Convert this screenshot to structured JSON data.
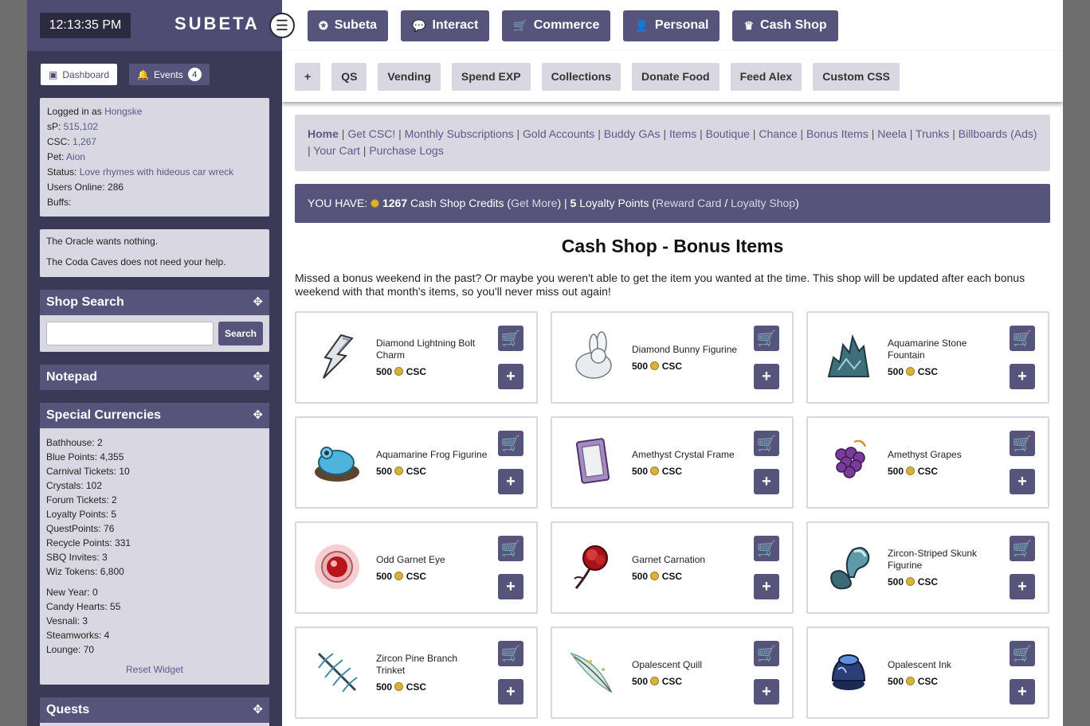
{
  "sidebar": {
    "clock": "12:13:35 PM",
    "brand": "SUBETA",
    "tabs": {
      "dashboard": "Dashboard",
      "events": "Events",
      "events_count": "4"
    },
    "user": {
      "logged_in_label": "Logged in as",
      "username": "Hongske",
      "sp_label": "sP:",
      "sp_value": "515,102",
      "csc_label": "CSC:",
      "csc_value": "1,267",
      "pet_label": "Pet:",
      "pet_value": "Aion",
      "status_label": "Status:",
      "status_value": "Love rhymes with hideous car wreck",
      "users_online": "Users Online: 286",
      "buffs": "Buffs:"
    },
    "oracle": {
      "line1": "The Oracle wants nothing.",
      "line2": "The Coda Caves does not need your help."
    },
    "shop_search": {
      "title": "Shop Search",
      "button": "Search",
      "placeholder": ""
    },
    "notepad": {
      "title": "Notepad"
    },
    "currencies": {
      "title": "Special Currencies",
      "group1": [
        "Bathhouse: 2",
        "Blue Points: 4,355",
        "Carnival Tickets: 10",
        "Crystals: 102",
        "Forum Tickets: 2",
        "Loyalty Points: 5",
        "QuestPoints: 76",
        "Recycle Points: 331",
        "SBQ Invites: 3",
        "Wiz Tokens: 6,800"
      ],
      "group2": [
        "New Year: 0",
        "Candy Hearts: 55",
        "Vesnali: 3",
        "Steamworks: 4",
        "Lounge: 70"
      ],
      "reset": "Reset Widget"
    },
    "quests": {
      "title": "Quests"
    }
  },
  "topnav": [
    {
      "label": "Subeta",
      "icon": "compass-icon",
      "glyph": "✪"
    },
    {
      "label": "Interact",
      "icon": "chat-icon",
      "glyph": "💬"
    },
    {
      "label": "Commerce",
      "icon": "cart-icon",
      "glyph": "🛒"
    },
    {
      "label": "Personal",
      "icon": "user-icon",
      "glyph": "👤"
    },
    {
      "label": "Cash Shop",
      "icon": "crown-icon",
      "glyph": "♛"
    }
  ],
  "subnav": [
    "+",
    "QS",
    "Vending",
    "Spend EXP",
    "Collections",
    "Donate Food",
    "Feed Alex",
    "Custom CSS"
  ],
  "breadcrumb": [
    "Home",
    "Get CSC!",
    "Monthly Subscriptions",
    "Gold Accounts",
    "Buddy GAs",
    "Items",
    "Boutique",
    "Chance",
    "Bonus Items",
    "Neela",
    "Trunks",
    "Billboards (Ads)",
    "Your Cart",
    "Purchase Logs"
  ],
  "balance": {
    "you_have": "YOU HAVE:",
    "credits": "1267",
    "credits_label": "Cash Shop Credits (",
    "get_more": "Get More",
    "sep": ") |",
    "loyalty": "5",
    "loyalty_label": "Loyalty Points (",
    "reward_card": "Reward Card",
    "slash": " / ",
    "loyalty_shop": "Loyalty Shop",
    "close": ")"
  },
  "page_title": "Cash Shop - Bonus Items",
  "intro": "Missed a bonus weekend in the past? Or maybe you weren't able to get the item you wanted at the time. This shop will be updated after each bonus weekend with that month's items, so you'll never miss out again!",
  "items": [
    {
      "name": "Diamond Lightning Bolt Charm",
      "price": "500",
      "currency": "CSC",
      "kind": "bolt"
    },
    {
      "name": "Diamond Bunny Figurine",
      "price": "500",
      "currency": "CSC",
      "kind": "bunny"
    },
    {
      "name": "Aquamarine Stone Fountain",
      "price": "500",
      "currency": "CSC",
      "kind": "fountain"
    },
    {
      "name": "Aquamarine Frog Figurine",
      "price": "500",
      "currency": "CSC",
      "kind": "frog"
    },
    {
      "name": "Amethyst Crystal Frame",
      "price": "500",
      "currency": "CSC",
      "kind": "frame"
    },
    {
      "name": "Amethyst Grapes",
      "price": "500",
      "currency": "CSC",
      "kind": "grapes"
    },
    {
      "name": "Odd Garnet Eye",
      "price": "500",
      "currency": "CSC",
      "kind": "eye"
    },
    {
      "name": "Garnet Carnation",
      "price": "500",
      "currency": "CSC",
      "kind": "flower"
    },
    {
      "name": "Zircon-Striped Skunk Figurine",
      "price": "500",
      "currency": "CSC",
      "kind": "skunk"
    },
    {
      "name": "Zircon Pine Branch Trinket",
      "price": "500",
      "currency": "CSC",
      "kind": "pine"
    },
    {
      "name": "Opalescent Quill",
      "price": "500",
      "currency": "CSC",
      "kind": "quill"
    },
    {
      "name": "Opalescent Ink",
      "price": "500",
      "currency": "CSC",
      "kind": "ink"
    }
  ],
  "colors": {
    "accent": "#56547b",
    "panel": "#d9d8e2",
    "sidebar": "#3b3a56",
    "coin": "#d8b23a"
  }
}
